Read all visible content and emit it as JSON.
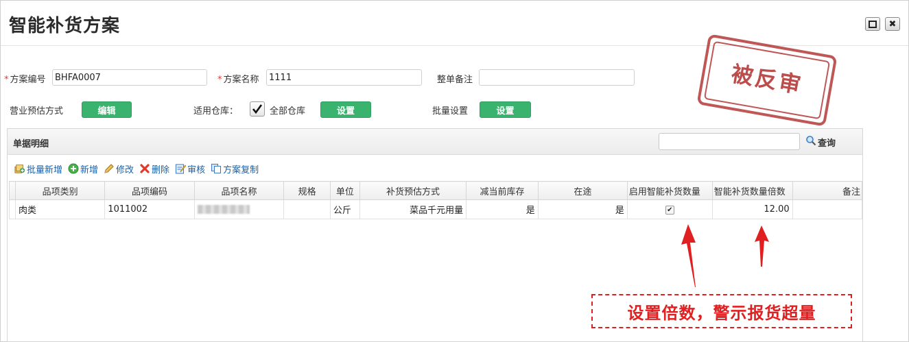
{
  "window": {
    "title": "智能补货方案",
    "maximize_icon": "maximize-icon",
    "close_icon": "close-icon"
  },
  "form": {
    "plan_code": {
      "required_mark": "*",
      "label": "方案编号",
      "value": "BHFA0007"
    },
    "plan_name": {
      "required_mark": "*",
      "label": "方案名称",
      "value": "1111"
    },
    "remark": {
      "label": "整单备注",
      "value": ""
    },
    "business_estimate": {
      "label": "营业预估方式",
      "button": "编辑"
    },
    "warehouse": {
      "label": "适用仓库：",
      "checkbox_label": "全部仓库",
      "checked": true,
      "button": "设置"
    },
    "batch_setting": {
      "label": "批量设置",
      "button": "设置"
    }
  },
  "stamp": {
    "text": "被反审",
    "color": "#b43a3a"
  },
  "detail": {
    "title": "单据明细",
    "search": {
      "placeholder": "",
      "button": "查询",
      "icon": "magnifier-icon"
    },
    "toolbar": [
      {
        "label": "批量新增",
        "icon": "batch-add-icon"
      },
      {
        "label": "新增",
        "icon": "add-icon"
      },
      {
        "label": "修改",
        "icon": "pencil-icon"
      },
      {
        "label": "删除",
        "icon": "delete-icon"
      },
      {
        "label": "审核",
        "icon": "audit-icon"
      },
      {
        "label": "方案复制",
        "icon": "copy-icon"
      }
    ],
    "columns": [
      "品项类别",
      "品项编码",
      "品项名称",
      "规格",
      "单位",
      "补货预估方式",
      "减当前库存",
      "在途",
      "启用智能补货数量",
      "智能补货数量倍数",
      "备注"
    ],
    "rows": [
      {
        "category": "肉类",
        "code": "1011002",
        "name": "",
        "spec": "",
        "unit": "公斤",
        "estimate_method": "菜品千元用量",
        "deduct_stock": "是",
        "in_transit": "是",
        "smart_enabled": true,
        "multiple": "12.00",
        "remark": ""
      }
    ]
  },
  "annotation": {
    "callout": "设置倍数，警示报货超量",
    "color": "#e02020"
  },
  "colors": {
    "green_button": "#39b36e",
    "required_mark": "#e33333",
    "link_blue": "#1a5fa8"
  }
}
